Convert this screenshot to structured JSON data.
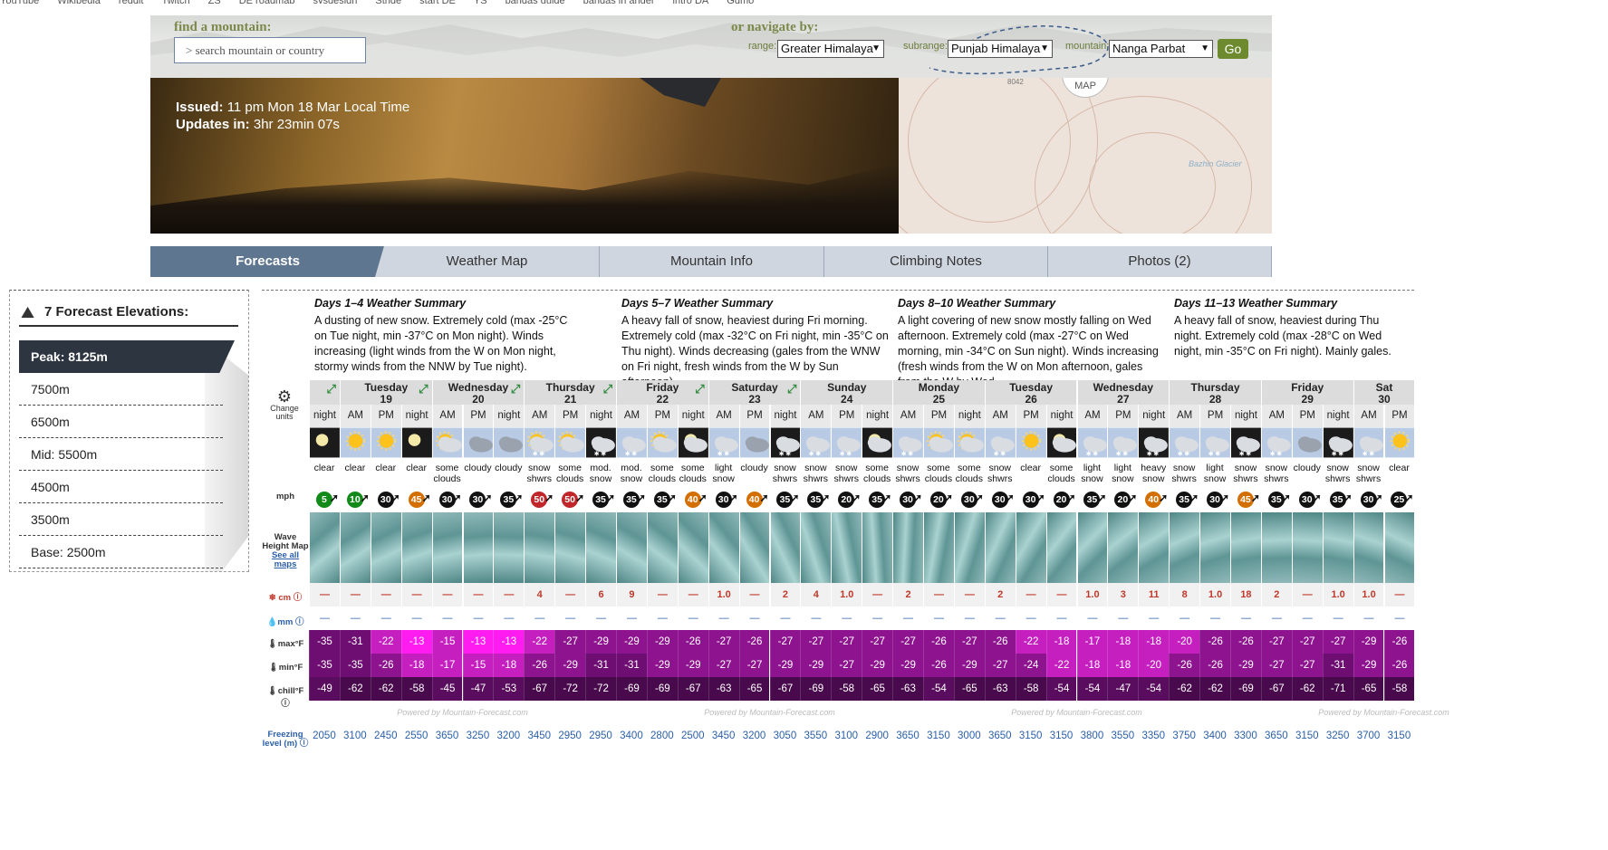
{
  "bookmarks": [
    "YouTube",
    "Wikipedia",
    "reddit",
    "Twitch",
    "ZS",
    "DE roadmap",
    "sysdesign",
    "Stride",
    "start DE",
    "YS",
    "pandas guide",
    "pandas in anger",
    "intro DA",
    "Gdmo"
  ],
  "header": {
    "find_label": "find a mountain:",
    "search_placeholder": "> search mountain or country",
    "nav_label": "or navigate by:",
    "range_label": "range:",
    "range_value": "Greater Himalaya",
    "subrange_label": "subrange:",
    "subrange_value": "Punjab Himalaya",
    "mountain_label": "mountain:",
    "mountain_value": "Nanga Parbat",
    "go_label": "Go"
  },
  "banner": {
    "issued_label": "Issued:",
    "issued_value": "11 pm Mon 18 Mar Local Time",
    "updates_label": "Updates in:",
    "updates_value": "3hr 23min 07s",
    "map_label": "MAP",
    "map_height": "8042",
    "map_glacier": "Bazhin Glacier"
  },
  "tabs": [
    "Forecasts",
    "Weather Map",
    "Mountain Info",
    "Climbing Notes",
    "Photos (2)"
  ],
  "elevations": {
    "title": "7 Forecast Elevations:",
    "items": [
      "Peak: 8125m",
      "7500m",
      "6500m",
      "Mid: 5500m",
      "4500m",
      "3500m",
      "Base: 2500m"
    ]
  },
  "summaries": [
    {
      "title": "Days 1–4 Weather Summary",
      "text": "A dusting of new snow. Extremely cold (max -25°C on Tue night, min -37°C on Mon night). Winds increasing (light winds from the W on Mon night, stormy winds from the NNW by Tue night)."
    },
    {
      "title": "Days 5–7 Weather Summary",
      "text": "A heavy fall of snow, heaviest during Fri morning. Extremely cold (max -32°C on Fri night, min -35°C on Thu night). Winds decreasing (gales from the WNW on Fri night, fresh winds from the W by Sun afternoon)."
    },
    {
      "title": "Days 8–10 Weather Summary",
      "text": "A light covering of new snow mostly falling on Wed afternoon. Extremely cold (max -27°C on Wed morning, min -34°C on Sun night). Winds increasing (fresh winds from the W on Mon afternoon, gales from the W by Wed"
    },
    {
      "title": "Days 11–13 Weather Summary",
      "text": "A heavy fall of snow, heaviest during Thu night. Extremely cold (max -28°C on Wed night, min -35°C on Fri night). Mainly gales."
    }
  ],
  "row_labels": {
    "change_units": "Change units",
    "wind_unit": "mph",
    "wave_map": "Wave Height Map",
    "see_all": "See all maps",
    "snow": "cm",
    "rain": "mm",
    "max": "max°F",
    "min": "min°F",
    "chill": "chill°F",
    "freezing": "Freezing level (m)"
  },
  "powered": "Powered by Mountain-Forecast.com",
  "days": [
    {
      "name": "",
      "date": "",
      "periods": [
        "night"
      ]
    },
    {
      "name": "Tuesday",
      "date": "19",
      "periods": [
        "AM",
        "PM",
        "night"
      ]
    },
    {
      "name": "Wednesday",
      "date": "20",
      "periods": [
        "AM",
        "PM",
        "night"
      ]
    },
    {
      "name": "Thursday",
      "date": "21",
      "periods": [
        "AM",
        "PM",
        "night"
      ]
    },
    {
      "name": "Friday",
      "date": "22",
      "periods": [
        "AM",
        "PM",
        "night"
      ]
    },
    {
      "name": "Saturday",
      "date": "23",
      "periods": [
        "AM",
        "PM",
        "night"
      ]
    },
    {
      "name": "Sunday",
      "date": "24",
      "periods": [
        "AM",
        "PM",
        "night"
      ]
    },
    {
      "name": "Monday",
      "date": "25",
      "periods": [
        "AM",
        "PM",
        "night"
      ]
    },
    {
      "name": "Tuesday",
      "date": "26",
      "periods": [
        "AM",
        "PM",
        "night"
      ]
    },
    {
      "name": "Wednesday",
      "date": "27",
      "periods": [
        "AM",
        "PM",
        "night"
      ]
    },
    {
      "name": "Thursday",
      "date": "28",
      "periods": [
        "AM",
        "PM",
        "night"
      ]
    },
    {
      "name": "Friday",
      "date": "29",
      "periods": [
        "AM",
        "PM",
        "night"
      ]
    },
    {
      "name": "Sat",
      "date": "30",
      "periods": [
        "AM",
        "PM"
      ]
    }
  ],
  "forecast": {
    "icons": [
      "moon-clear",
      "sun",
      "sun",
      "moon-clear",
      "sun-cloud",
      "cloud",
      "cloud",
      "sun-cloud-snow",
      "sun-cloud",
      "cloud-snow-night",
      "cloud-snow",
      "sun-cloud",
      "moon-cloud",
      "cloud-snow",
      "cloud",
      "cloud-snow-night",
      "cloud-snow",
      "cloud-snow",
      "moon-cloud",
      "cloud-snow",
      "sun-cloud",
      "sun-cloud",
      "cloud-snow",
      "sun",
      "moon-cloud",
      "cloud-snow",
      "cloud-snow",
      "cloud-snow-night",
      "cloud-snow",
      "cloud-snow",
      "cloud-snow-night",
      "cloud-snow",
      "cloud",
      "cloud-snow-night",
      "cloud-snow",
      "sun"
    ],
    "desc": [
      "clear",
      "clear",
      "clear",
      "clear",
      "some clouds",
      "cloudy",
      "cloudy",
      "snow shwrs",
      "some clouds",
      "mod. snow",
      "mod. snow",
      "some clouds",
      "some clouds",
      "light snow",
      "cloudy",
      "snow shwrs",
      "snow shwrs",
      "snow shwrs",
      "some clouds",
      "snow shwrs",
      "some clouds",
      "some clouds",
      "snow shwrs",
      "clear",
      "some clouds",
      "light snow",
      "light snow",
      "heavy snow",
      "snow shwrs",
      "light snow",
      "snow shwrs",
      "snow shwrs",
      "cloudy",
      "snow shwrs",
      "snow shwrs",
      "clear"
    ],
    "wind": [
      5,
      10,
      30,
      45,
      30,
      30,
      35,
      50,
      50,
      35,
      35,
      35,
      40,
      30,
      40,
      35,
      35,
      20,
      35,
      30,
      20,
      30,
      30,
      30,
      20,
      35,
      20,
      40,
      35,
      30,
      45,
      35,
      30,
      35,
      30,
      25
    ],
    "snow": [
      "—",
      "—",
      "—",
      "—",
      "—",
      "—",
      "—",
      "4",
      "—",
      "6",
      "9",
      "—",
      "—",
      "1.0",
      "—",
      "2",
      "4",
      "1.0",
      "—",
      "2",
      "—",
      "—",
      "2",
      "—",
      "—",
      "1.0",
      "3",
      "11",
      "8",
      "1.0",
      "18",
      "2",
      "—",
      "1.0",
      "1.0",
      "—"
    ],
    "rain": [
      "—",
      "—",
      "—",
      "—",
      "—",
      "—",
      "—",
      "—",
      "—",
      "—",
      "—",
      "—",
      "—",
      "—",
      "—",
      "—",
      "—",
      "—",
      "—",
      "—",
      "—",
      "—",
      "—",
      "—",
      "—",
      "—",
      "—",
      "—",
      "—",
      "—",
      "—",
      "—",
      "—",
      "—",
      "—",
      "—"
    ],
    "max": [
      -35,
      -31,
      -22,
      -13,
      -15,
      -13,
      -13,
      -22,
      -27,
      -29,
      -29,
      -29,
      -26,
      -27,
      -26,
      -27,
      -27,
      -27,
      -27,
      -27,
      -26,
      -27,
      -26,
      -22,
      -18,
      -17,
      -18,
      -18,
      -20,
      -26,
      -26,
      -27,
      -27,
      -27,
      -29,
      -26
    ],
    "min": [
      -35,
      -35,
      -26,
      -18,
      -17,
      -15,
      -18,
      -26,
      -29,
      -31,
      -31,
      -29,
      -29,
      -27,
      -27,
      -29,
      -29,
      -27,
      -29,
      -29,
      -26,
      -29,
      -27,
      -24,
      -22,
      -18,
      -18,
      -20,
      -26,
      -26,
      -29,
      -27,
      -27,
      -31,
      -29,
      -26
    ],
    "chill": [
      -49,
      -62,
      -62,
      -58,
      -45,
      -47,
      -53,
      -67,
      -72,
      -72,
      -69,
      -69,
      -67,
      -63,
      -65,
      -67,
      -69,
      -58,
      -65,
      -63,
      -54,
      -65,
      -63,
      -58,
      -54,
      -54,
      -47,
      -54,
      -62,
      -62,
      -69,
      -67,
      -62,
      -71,
      -65,
      -58
    ],
    "freezing": [
      2050,
      3100,
      2450,
      2550,
      3650,
      3250,
      3200,
      3450,
      2950,
      2950,
      3400,
      2800,
      2500,
      3450,
      3200,
      3050,
      3550,
      3100,
      2900,
      3650,
      3150,
      3000,
      3650,
      3150,
      3150,
      3800,
      3550,
      3350,
      3750,
      3400,
      3300,
      3650,
      3150,
      3250,
      3700,
      3150
    ]
  },
  "colors": {
    "tab_active": "#5f7690",
    "tab_inactive": "#cfd6e0",
    "go_button": "#6d8a2e",
    "label_green": "#7a8a4c",
    "temp_deep": "#5e0f6b",
    "temp_hot": "#ff00ff",
    "snow_red": "#c0392b",
    "link_blue": "#2b5fa8"
  }
}
